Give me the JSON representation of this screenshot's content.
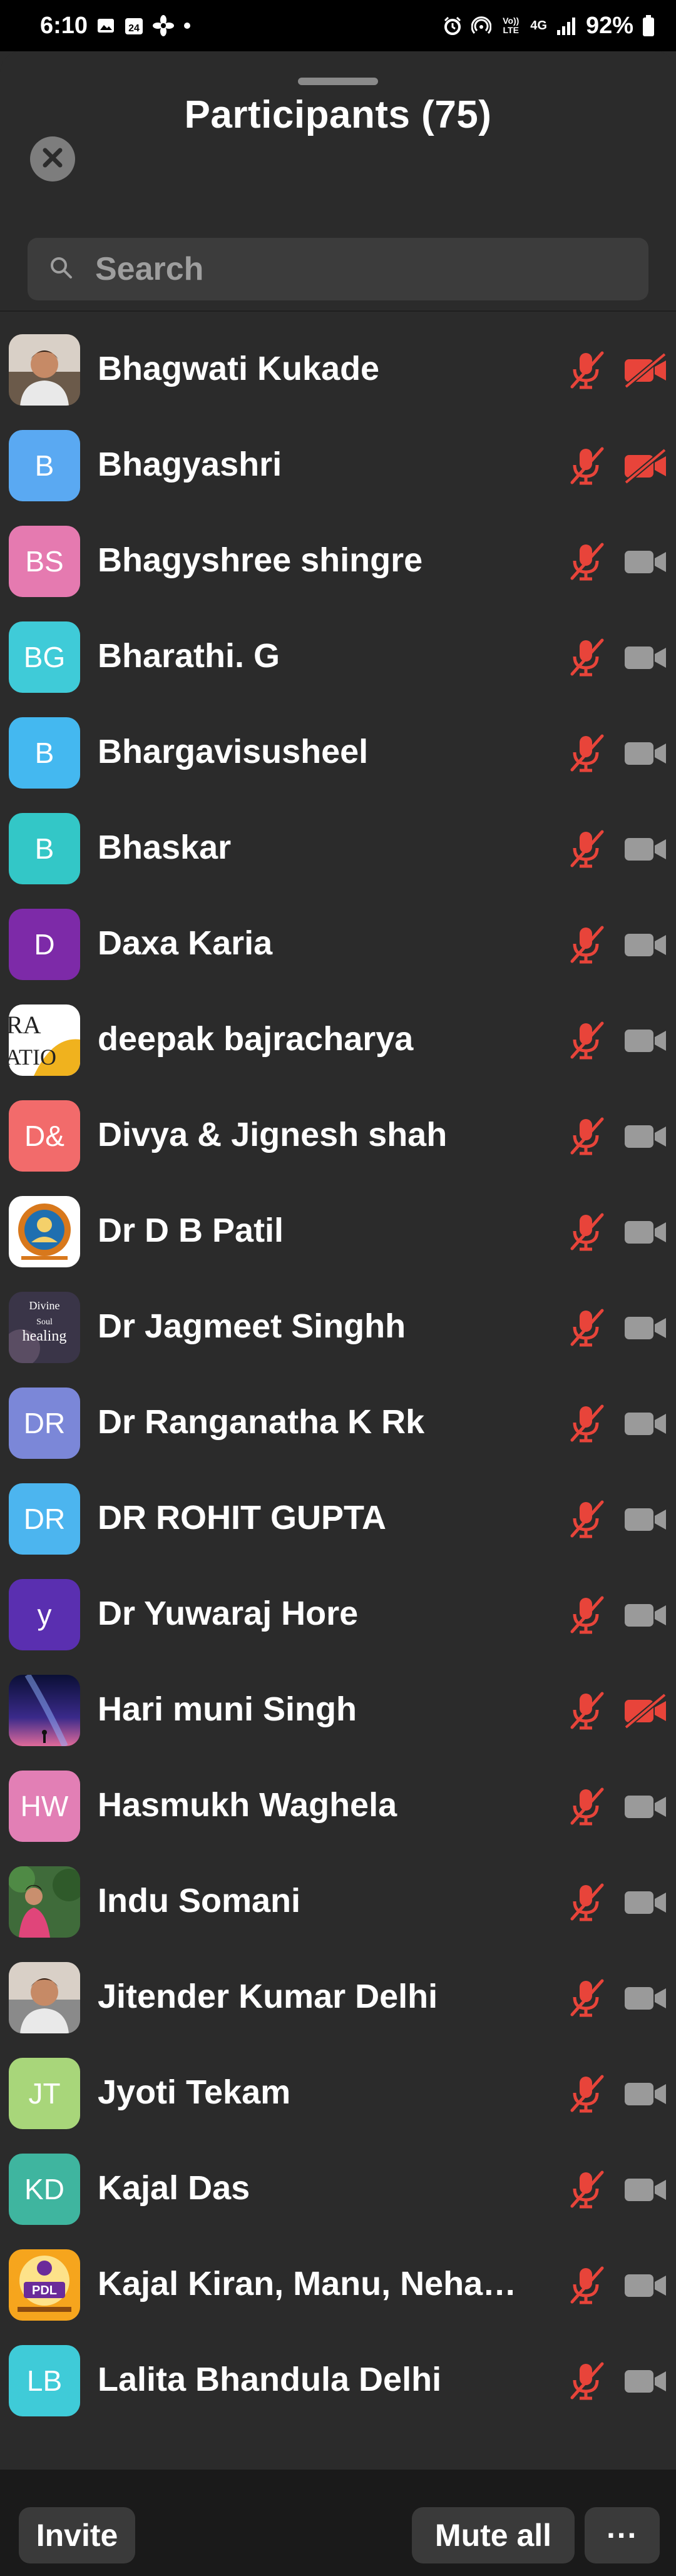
{
  "status_bar": {
    "time": "6:10",
    "calendar_day": "24",
    "network": "4G",
    "volte": "Vo)) LTE",
    "battery": "92%"
  },
  "sheet": {
    "title": "Participants (75)"
  },
  "search": {
    "placeholder": "Search"
  },
  "participants": [
    {
      "name": "Bhagwati Kukade",
      "initials": "",
      "avatar_color": "#6b5a4a",
      "avatar_kind": "photo-person",
      "mic_muted": true,
      "video_off": true
    },
    {
      "name": "Bhagyashri",
      "initials": "B",
      "avatar_color": "#5aa9f2",
      "avatar_kind": "initials",
      "mic_muted": true,
      "video_off": true
    },
    {
      "name": "Bhagyshree shingre",
      "initials": "BS",
      "avatar_color": "#e57ab0",
      "avatar_kind": "initials",
      "mic_muted": true,
      "video_off": false
    },
    {
      "name": "Bharathi. G",
      "initials": "BG",
      "avatar_color": "#3fcbd8",
      "avatar_kind": "initials",
      "mic_muted": true,
      "video_off": false
    },
    {
      "name": "Bhargavisusheel",
      "initials": "B",
      "avatar_color": "#44b8f0",
      "avatar_kind": "initials",
      "mic_muted": true,
      "video_off": false
    },
    {
      "name": "Bhaskar",
      "initials": "B",
      "avatar_color": "#33c7c7",
      "avatar_kind": "initials",
      "mic_muted": true,
      "video_off": false
    },
    {
      "name": "Daxa Karia",
      "initials": "D",
      "avatar_color": "#7d2aa8",
      "avatar_kind": "initials",
      "mic_muted": true,
      "video_off": false
    },
    {
      "name": "deepak bajracharya",
      "initials": "",
      "avatar_color": "#f2f2f2",
      "avatar_kind": "photo-logo-text",
      "mic_muted": true,
      "video_off": false
    },
    {
      "name": "Divya & Jignesh shah",
      "initials": "D&",
      "avatar_color": "#f26b6b",
      "avatar_kind": "initials",
      "mic_muted": true,
      "video_off": false
    },
    {
      "name": "Dr D B Patil",
      "initials": "",
      "avatar_color": "#e9d5b5",
      "avatar_kind": "photo-emblem",
      "mic_muted": true,
      "video_off": false
    },
    {
      "name": "Dr Jagmeet Singhh",
      "initials": "",
      "avatar_color": "#2a2a3a",
      "avatar_kind": "photo-healing",
      "mic_muted": true,
      "video_off": false
    },
    {
      "name": "Dr Ranganatha K Rk",
      "initials": "DR",
      "avatar_color": "#7b87d8",
      "avatar_kind": "initials",
      "mic_muted": true,
      "video_off": false
    },
    {
      "name": "DR ROHIT GUPTA",
      "initials": "DR",
      "avatar_color": "#4cb5ef",
      "avatar_kind": "initials",
      "mic_muted": true,
      "video_off": false
    },
    {
      "name": "Dr Yuwaraj Hore",
      "initials": "y",
      "avatar_color": "#5a2fb0",
      "avatar_kind": "initials",
      "mic_muted": true,
      "video_off": false
    },
    {
      "name": "Hari muni Singh",
      "initials": "",
      "avatar_color": "#1d1f5c",
      "avatar_kind": "photo-space",
      "mic_muted": true,
      "video_off": true
    },
    {
      "name": "Hasmukh Waghela",
      "initials": "HW",
      "avatar_color": "#e27fb5",
      "avatar_kind": "initials",
      "mic_muted": true,
      "video_off": false
    },
    {
      "name": "Indu Somani",
      "initials": "",
      "avatar_color": "#3f6b3a",
      "avatar_kind": "photo-garden",
      "mic_muted": true,
      "video_off": false
    },
    {
      "name": "Jitender Kumar Delhi",
      "initials": "",
      "avatar_color": "#8a8a8a",
      "avatar_kind": "photo-person",
      "mic_muted": true,
      "video_off": false
    },
    {
      "name": "Jyoti Tekam",
      "initials": "JT",
      "avatar_color": "#a8d67a",
      "avatar_kind": "initials",
      "mic_muted": true,
      "video_off": false
    },
    {
      "name": "Kajal Das",
      "initials": "KD",
      "avatar_color": "#3fb59f",
      "avatar_kind": "initials",
      "mic_muted": true,
      "video_off": false
    },
    {
      "name": "Kajal Kiran, Manu, Neha…",
      "initials": "",
      "avatar_color": "#f4a21c",
      "avatar_kind": "photo-pdl",
      "logo_text": "PDL",
      "mic_muted": true,
      "video_off": false
    },
    {
      "name": "Lalita Bhandula Delhi",
      "initials": "LB",
      "avatar_color": "#3fcbd8",
      "avatar_kind": "initials",
      "mic_muted": true,
      "video_off": false
    }
  ],
  "avatar_photo_text": {
    "deepak": [
      "RA",
      "ATIO"
    ],
    "healing": [
      "Divine",
      "Soul",
      "healing"
    ]
  },
  "footer": {
    "invite_label": "Invite",
    "mute_all_label": "Mute all",
    "more_label": "···"
  },
  "colors": {
    "muted_red": "#e8443a",
    "cam_gray": "#9a9a9a",
    "background": "#2b2b2b"
  },
  "icons": {
    "close": "close-icon",
    "search": "search-icon",
    "mic_muted": "mic-off-icon",
    "camera": "video-camera-icon",
    "camera_off": "video-off-icon"
  }
}
